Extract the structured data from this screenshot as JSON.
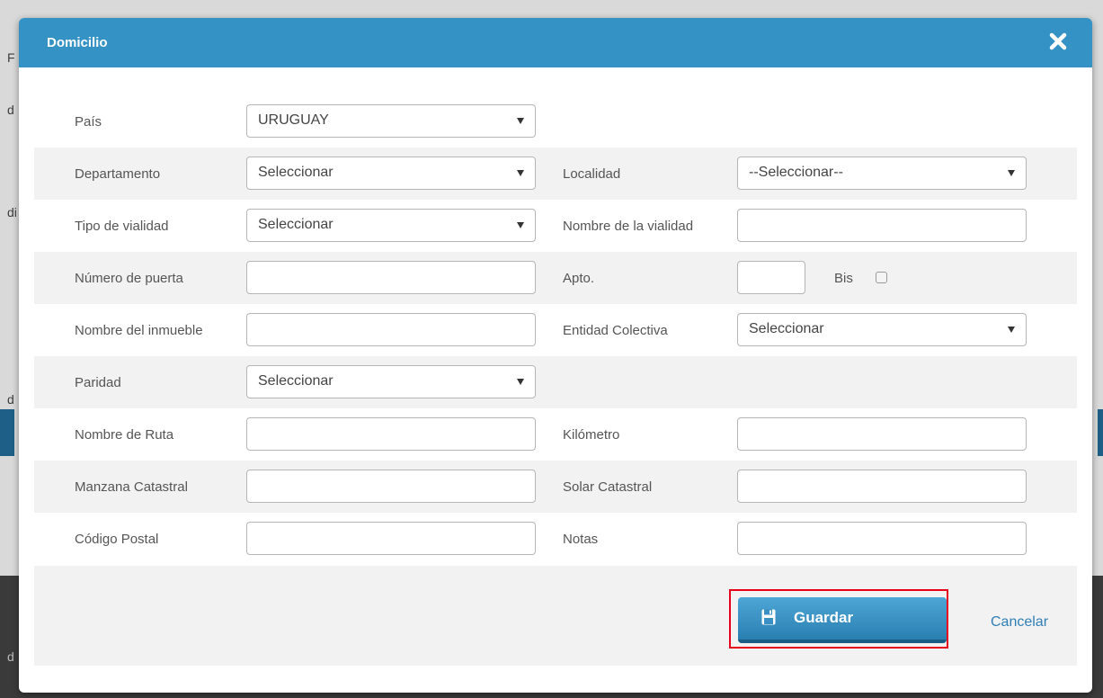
{
  "background": {
    "fragments": [
      "F",
      "d",
      "di",
      "d",
      "d"
    ]
  },
  "modal": {
    "title": "Domicilio",
    "close_icon": "close-icon"
  },
  "form": {
    "pais": {
      "label": "País",
      "value": "URUGUAY"
    },
    "departamento": {
      "label": "Departamento",
      "value": "Seleccionar"
    },
    "localidad": {
      "label": "Localidad",
      "value": "--Seleccionar--"
    },
    "tipo_vialidad": {
      "label": "Tipo de vialidad",
      "value": "Seleccionar"
    },
    "nombre_vialidad": {
      "label": "Nombre de la vialidad",
      "value": ""
    },
    "numero_puerta": {
      "label": "Número de puerta",
      "value": ""
    },
    "apto": {
      "label": "Apto.",
      "value": ""
    },
    "bis": {
      "label": "Bis",
      "checked": false
    },
    "nombre_inmueble": {
      "label": "Nombre del inmueble",
      "value": ""
    },
    "entidad_colectiva": {
      "label": "Entidad Colectiva",
      "value": "Seleccionar"
    },
    "paridad": {
      "label": "Paridad",
      "value": "Seleccionar"
    },
    "nombre_ruta": {
      "label": "Nombre de Ruta",
      "value": ""
    },
    "kilometro": {
      "label": "Kilómetro",
      "value": ""
    },
    "manzana_catastral": {
      "label": "Manzana Catastral",
      "value": ""
    },
    "solar_catastral": {
      "label": "Solar Catastral",
      "value": ""
    },
    "codigo_postal": {
      "label": "Código Postal",
      "value": ""
    },
    "notas": {
      "label": "Notas",
      "value": ""
    }
  },
  "footer": {
    "save_label": "Guardar",
    "cancel_label": "Cancelar"
  },
  "colors": {
    "header": "#3592c4",
    "highlight": "#e8001c",
    "link": "#2f7fb5"
  }
}
